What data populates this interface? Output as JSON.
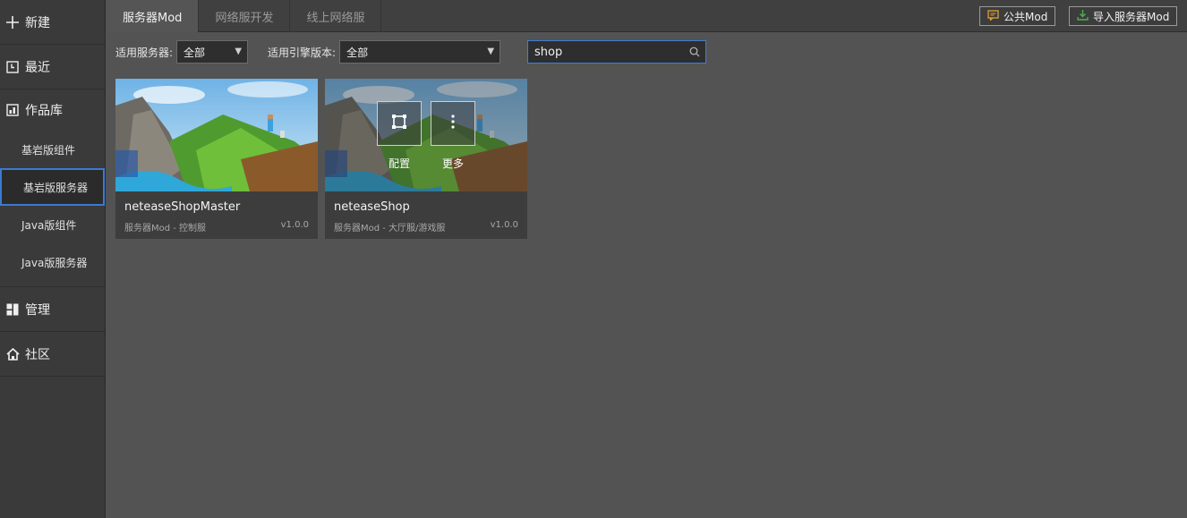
{
  "sidebar": {
    "new_label": "新建",
    "recent_label": "最近",
    "works_label": "作品库",
    "works_items": [
      {
        "label": "基岩版组件"
      },
      {
        "label": "基岩版服务器"
      },
      {
        "label": "Java版组件"
      },
      {
        "label": "Java版服务器"
      }
    ],
    "manage_label": "管理",
    "community_label": "社区"
  },
  "tabs": [
    {
      "label": "服务器Mod"
    },
    {
      "label": "网络服开发"
    },
    {
      "label": "线上网络服"
    }
  ],
  "toolbar": {
    "public_mod_label": "公共Mod",
    "import_mod_label": "导入服务器Mod"
  },
  "filters": {
    "server_label": "适用服务器:",
    "server_value": "全部",
    "engine_label": "适用引擎版本:",
    "engine_value": "全部",
    "search_value": "shop"
  },
  "cards": [
    {
      "title": "neteaseShopMaster",
      "meta": "服务器Mod - 控制服",
      "version": "v1.0.0"
    },
    {
      "title": "neteaseShop",
      "meta": "服务器Mod - 大厅服/游戏服",
      "version": "v1.0.0",
      "config_label": "配置",
      "more_label": "更多"
    }
  ],
  "colors": {
    "accent_blue": "#3b7ad3",
    "public_icon": "#e0a030",
    "import_icon": "#4caf50"
  }
}
